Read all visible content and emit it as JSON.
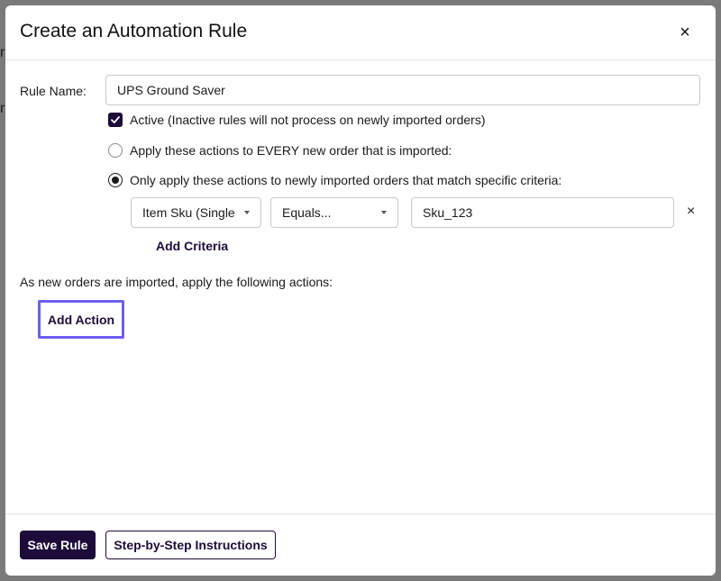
{
  "background": {
    "letters": [
      "r",
      "r"
    ]
  },
  "modal": {
    "title": "Create an Automation Rule",
    "close_label": "×"
  },
  "form": {
    "rule_name_label": "Rule Name:",
    "rule_name_value": "UPS Ground Saver",
    "active": {
      "checked": true,
      "label": "Active (Inactive rules will not process on newly imported orders)"
    },
    "scope_options": [
      {
        "label": "Apply these actions to EVERY new order that is imported:",
        "selected": false
      },
      {
        "label": "Only apply these actions to newly imported orders that match specific criteria:",
        "selected": true
      }
    ],
    "criteria": {
      "field_select": "Item Sku (Single",
      "operator_select": "Equals...",
      "value": "Sku_123",
      "remove_label": "×",
      "add_label": "Add Criteria"
    },
    "actions_description": "As new orders are imported, apply the following actions:",
    "add_action_label": "Add Action"
  },
  "footer": {
    "save_label": "Save Rule",
    "help_label": "Step-by-Step Instructions"
  },
  "colors": {
    "primary": "#1d0b3a",
    "focus_ring": "#6b5ef0",
    "overlay": "#7a7a7a"
  }
}
